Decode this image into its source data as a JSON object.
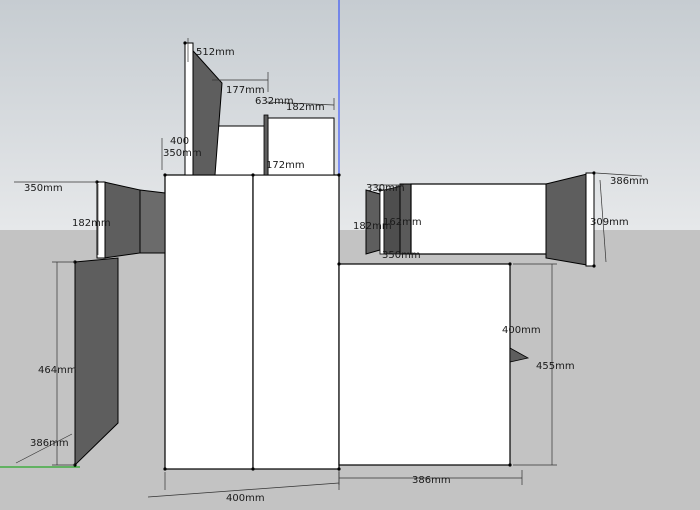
{
  "app": "SketchUp",
  "view": {
    "sky_top": "#c7cdd2",
    "sky_bottom": "#e4e7e9",
    "ground": "#c4c4c4"
  },
  "colors": {
    "face": "#ffffff",
    "shade": "#5e5e5e",
    "edge": "#000000",
    "axis_blue": "#1f3fff",
    "axis_green": "#00a000"
  },
  "dimensions": {
    "d1": "512mm",
    "d2": "177mm",
    "d3": "632mm",
    "d4": "182mm",
    "d5": "400",
    "d6": "350mm",
    "d7": "172mm",
    "d8": "350mm",
    "d9": "182mm",
    "d10": "464mm",
    "d11": "386mm",
    "d12": "400mm",
    "d13": "330mm",
    "d14": "162mm",
    "d15": "182mm",
    "d16": "350mm",
    "d17": "386mm",
    "d18": "309mm",
    "d19": "400mm",
    "d20": "455mm",
    "d21": "386mm"
  }
}
